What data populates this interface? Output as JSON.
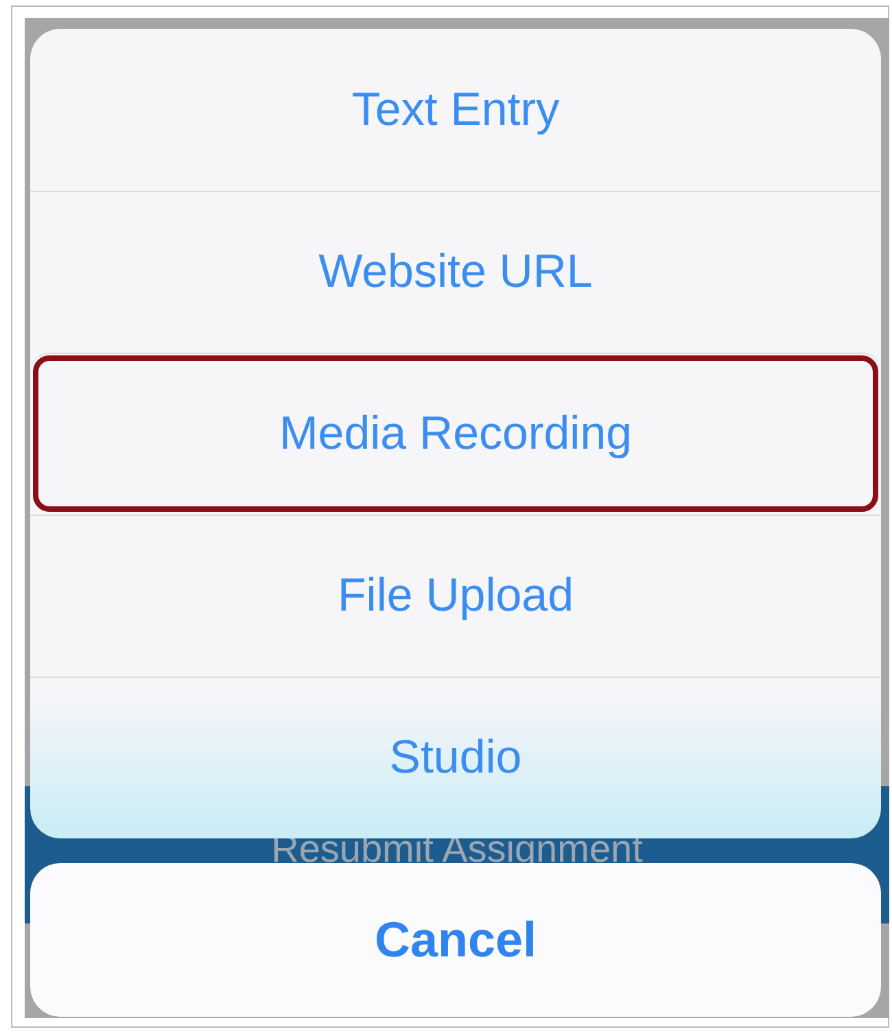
{
  "background": {
    "button_label": "Resubmit Assignment"
  },
  "action_sheet": {
    "options": [
      {
        "label": "Text Entry",
        "highlighted": false
      },
      {
        "label": "Website URL",
        "highlighted": false
      },
      {
        "label": "Media Recording",
        "highlighted": true
      },
      {
        "label": "File Upload",
        "highlighted": false
      },
      {
        "label": "Studio",
        "highlighted": false
      }
    ],
    "cancel": "Cancel"
  }
}
